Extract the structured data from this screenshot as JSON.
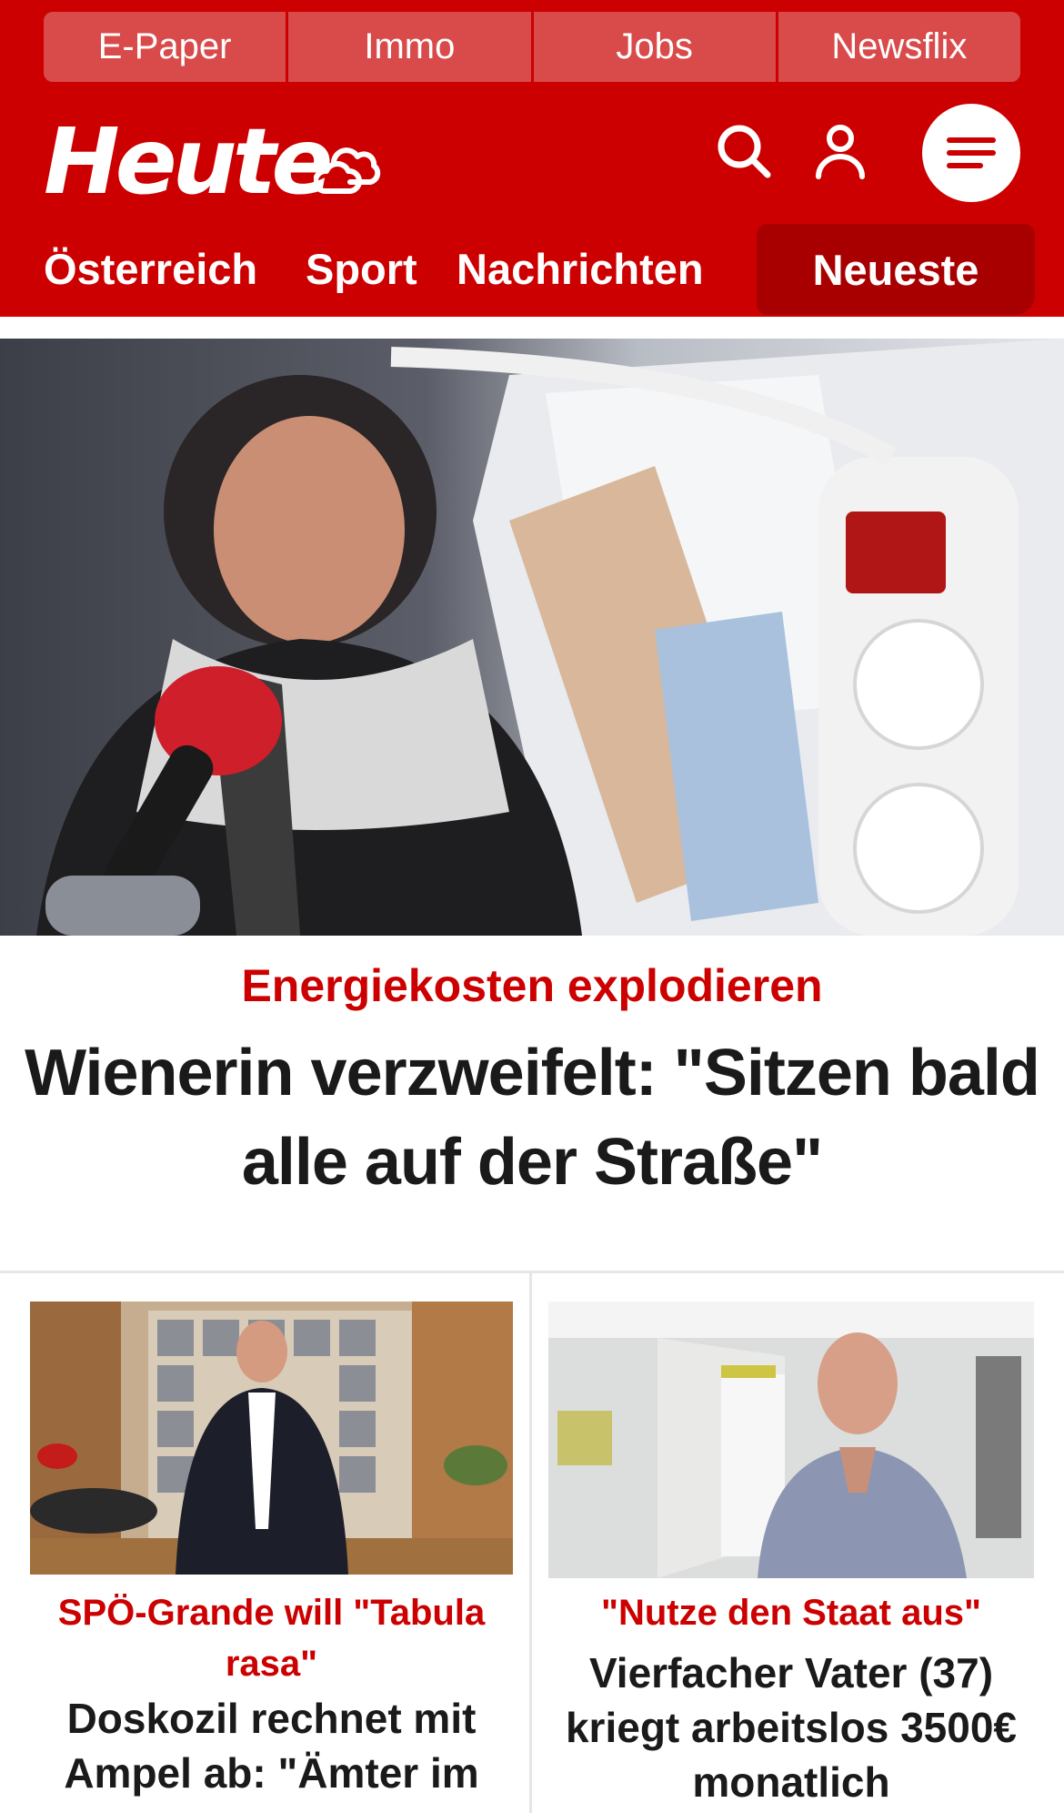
{
  "quicklinks": [
    {
      "label": "E-Paper"
    },
    {
      "label": "Immo"
    },
    {
      "label": "Jobs"
    },
    {
      "label": "Newsflix"
    }
  ],
  "header": {
    "logo_text": "Heute",
    "icons": [
      "weather-cloud-icon",
      "search-icon",
      "user-icon",
      "menu-icon"
    ]
  },
  "nav": {
    "items": [
      {
        "label": "Österreich"
      },
      {
        "label": "Sport"
      },
      {
        "label": "Nachrichten"
      }
    ],
    "active": {
      "label": "Neueste"
    }
  },
  "hero": {
    "kicker": "Energiekosten explodieren",
    "headline": "Wienerin verzweifelt: \"Sitzen bald alle auf der Straße\""
  },
  "teasers": [
    {
      "kicker": "SPÖ-Grande will \"Tabula rasa\"",
      "headline": "Doskozil rechnet mit Ampel ab: \"Ämter im"
    },
    {
      "kicker": "\"Nutze den Staat aus\"",
      "headline": "Vierfacher Vater (37) kriegt arbeitslos 3500€ monatlich"
    }
  ],
  "colors": {
    "brand_red": "#cc0000",
    "quicklink_bg": "#d94a4a",
    "nav_active_bg": "#a80000",
    "headline_text": "#1a1a1a"
  }
}
